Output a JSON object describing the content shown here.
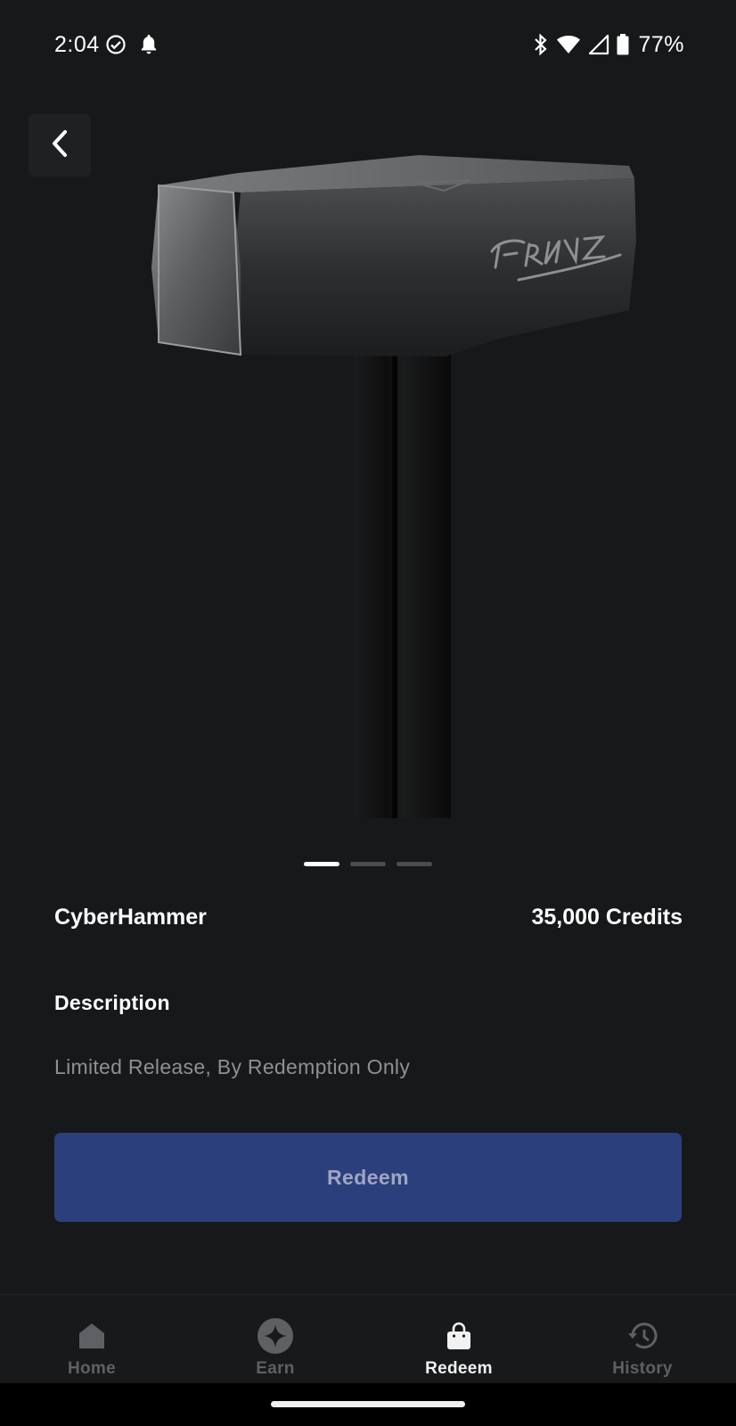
{
  "status_bar": {
    "time": "2:04",
    "battery_percent": "77%",
    "icons": [
      "check-circle-icon",
      "bell-icon",
      "bluetooth-icon",
      "wifi-icon",
      "cell-signal-icon",
      "battery-icon"
    ]
  },
  "product": {
    "name": "CyberHammer",
    "price": "35,000 Credits",
    "image_count": 3,
    "active_image_index": 0
  },
  "description": {
    "heading": "Description",
    "text": "Limited Release, By Redemption Only"
  },
  "actions": {
    "redeem_label": "Redeem"
  },
  "nav": {
    "items": [
      {
        "label": "Home",
        "icon": "home-icon"
      },
      {
        "label": "Earn",
        "icon": "star-badge-icon"
      },
      {
        "label": "Redeem",
        "icon": "shopping-bag-icon"
      },
      {
        "label": "History",
        "icon": "history-icon"
      }
    ],
    "active": "Redeem"
  },
  "colors": {
    "background": "#16181a",
    "button": "#2c3f7d",
    "button_text": "#9ea6c2",
    "muted_text": "#8e9094"
  }
}
